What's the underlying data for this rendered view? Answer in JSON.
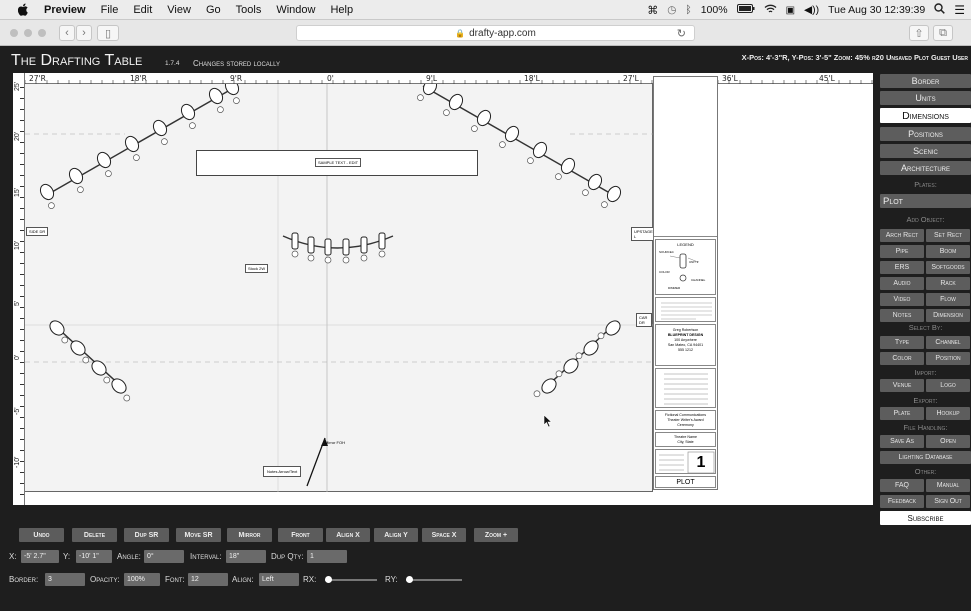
{
  "menubar": {
    "app": "Preview",
    "items": [
      "File",
      "Edit",
      "View",
      "Go",
      "Tools",
      "Window",
      "Help"
    ],
    "battery": "100%",
    "datetime": "Tue Aug 30 12:39:39"
  },
  "browser": {
    "url": "drafty-app.com"
  },
  "app": {
    "title": "The Drafting Table",
    "version": "1.7.4",
    "subtitle": "Changes stored locally",
    "status": "X-Pos: 4'-3\"R, Y-Pos: 3'-5\" Zoom: 45% r20 Unsaved Plot Guest User"
  },
  "ruler": {
    "top": [
      "27'R",
      "18'R",
      "9'R",
      "0'",
      "9'L",
      "18'L",
      "27'L",
      "36'L",
      "45'L"
    ],
    "left": [
      "25'",
      "20'",
      "15'",
      "10'",
      "5'",
      "0'",
      "-5'",
      "-10'"
    ]
  },
  "drawing": {
    "sample_text": "SAMPLE TEXT - EDIT",
    "pipe_label": "Stock 2W",
    "left_tag": "SIDE DR",
    "right_tag_upper": "UPSTAGE L",
    "right_tag_mid": "CAR DR",
    "note_label": "Notes Arrow/Text",
    "arrow_label": "Mirror FOH",
    "titleblock": {
      "legend_title": "LEGEND",
      "legend_items": [
        "SOURCE4",
        "UNIT #",
        "COLOR",
        "CHANNEL",
        "DIMMER"
      ],
      "company": "Greg Robertson",
      "company_sub": "BLUEPRINT DESIGN",
      "address": "100 Anywhere",
      "city": "San Mateo, CA 94401",
      "phone": "555 1212",
      "project": "Fictional Communications Theater Writer's Award Ceremony",
      "venue": "Theatre Name",
      "city2": "City, State",
      "plate_no": "1",
      "plate_label": "PLOT"
    }
  },
  "sidebar": {
    "views": [
      "Border",
      "Units",
      "Dimensions",
      "Positions",
      "Scenic",
      "Architecture"
    ],
    "active_view": "Dimensions",
    "plates_label": "Plates:",
    "plate": "Plot",
    "add_object_label": "Add Object:",
    "add_object": [
      [
        "Arch Rect",
        "Set Rect"
      ],
      [
        "Pipe",
        "Boom"
      ],
      [
        "ERS",
        "Softgoods"
      ],
      [
        "Audio",
        "Rack"
      ],
      [
        "Video",
        "Flow"
      ],
      [
        "Notes",
        "Dimension"
      ]
    ],
    "select_by_label": "Select By:",
    "select_by": [
      [
        "Type",
        "Channel"
      ],
      [
        "Color",
        "Position"
      ]
    ],
    "import_label": "Import:",
    "import": [
      [
        "Venue",
        "Logo"
      ]
    ],
    "export_label": "Export:",
    "export": [
      [
        "Plate",
        "Hookup"
      ]
    ],
    "file_label": "File Handling:",
    "file": [
      [
        "Save As",
        "Open"
      ]
    ],
    "lighting_db": "Lighting Database",
    "other_label": "Other:",
    "other": [
      [
        "FAQ",
        "Manual"
      ],
      [
        "Feedback",
        "Sign Out"
      ]
    ],
    "subscribe": "Subscribe"
  },
  "toolbar": {
    "buttons": [
      "Undo",
      "Delete",
      "Dup SR",
      "Move SR",
      "Mirror",
      "Front",
      "Align X",
      "Align Y",
      "Space X",
      "Zoom +"
    ],
    "x_label": "X:",
    "x_value": "-5' 2.7\"",
    "y_label": "Y:",
    "y_value": "-10' 1\"",
    "angle_label": "Angle:",
    "angle_value": "0°",
    "interval_label": "Interval:",
    "interval_value": "18\"",
    "dupqty_label": "Dup Qty:",
    "dupqty_value": "1",
    "border_label": "Border:",
    "border_value": "3",
    "opacity_label": "Opacity:",
    "opacity_value": "100%",
    "font_label": "Font:",
    "font_value": "12",
    "align_label": "Align:",
    "align_value": "Left",
    "rx_label": "RX:",
    "rx_value": 0,
    "ry_label": "RY:",
    "ry_value": 0
  }
}
